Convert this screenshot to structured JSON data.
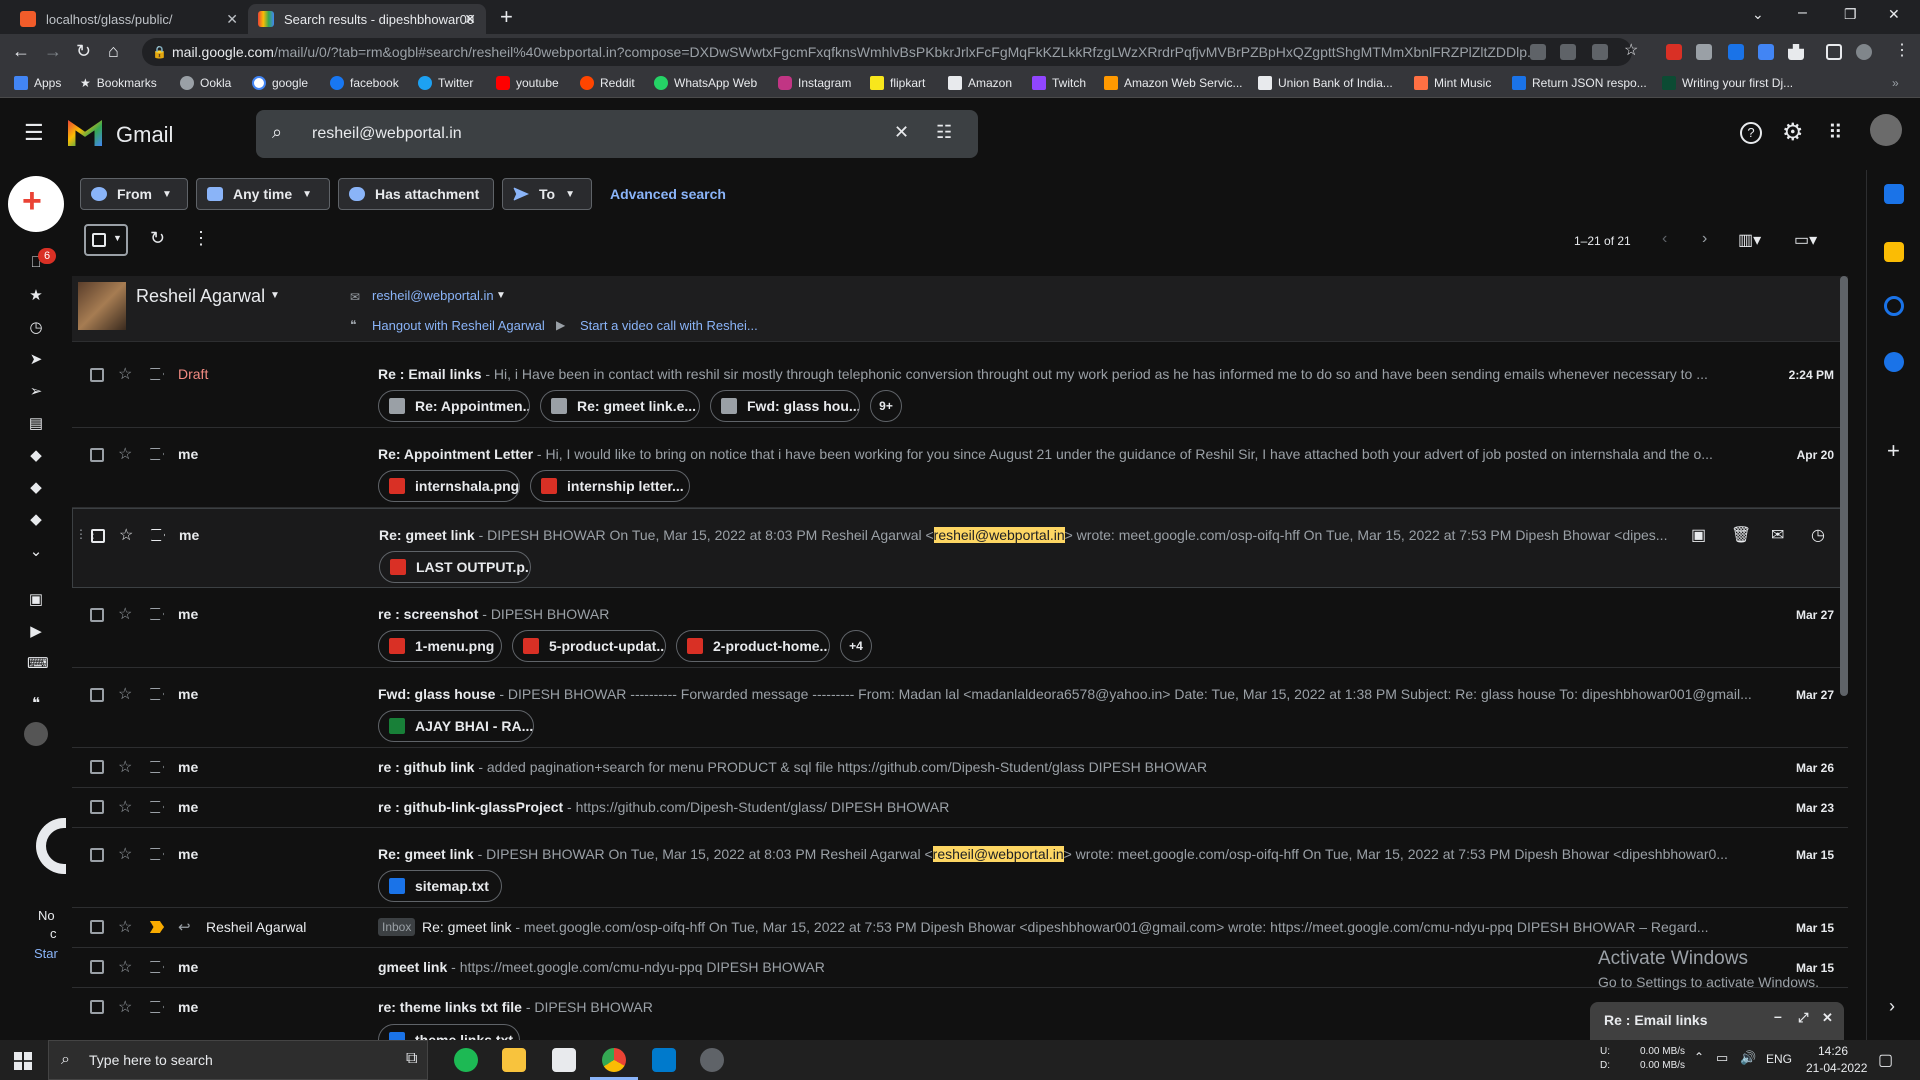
{
  "browser": {
    "tabs": [
      {
        "title": "localhost/glass/public/"
      },
      {
        "title": "Search results - dipeshbhowar00"
      }
    ],
    "url_host": "mail.google.com",
    "url_rest": "/mail/u/0/?tab=rm&ogbl#search/resheil%40webportal.in?compose=DXDwSWwtxFgcmFxqfknsWmhlvBsPKbkrJrlxFcFgMqFkKZLkkRfzgLWzXRrdrPqfjvMVBrPZBpHxQZgpttShgMTMmXbnlFRZPlZltZDDlp...",
    "bookmarks": [
      "Apps",
      "Bookmarks",
      "Ookla",
      "google",
      "facebook",
      "Twitter",
      "youtube",
      "Reddit",
      "WhatsApp Web",
      "Instagram",
      "flipkart",
      "Amazon",
      "Twitch",
      "Amazon Web Servic...",
      "Union Bank of India...",
      "Mint Music",
      "Return JSON respo...",
      "Writing your first Dj..."
    ]
  },
  "gmail": {
    "logo": "Gmail",
    "search_value": "resheil@webportal.in",
    "inbox_badge": "6",
    "filters": {
      "from": "From",
      "any_time": "Any time",
      "has_attachment": "Has attachment",
      "to": "To",
      "advanced": "Advanced search"
    },
    "pagination": "1–21 of 21",
    "contact": {
      "name": "Resheil Agarwal",
      "email": "resheil@webportal.in",
      "hangout": "Hangout with Resheil Agarwal",
      "video": "Start a video call with Reshei..."
    },
    "left_truncated": {
      "no": "No",
      "c": "c",
      "star": "Star"
    }
  },
  "emails": [
    {
      "sender": "Draft",
      "subject": "Re : Email links",
      "snippet": " - Hi, i Have been in contact with reshil sir mostly through telephonic conversion throught out my work period as he has informed me to do so and have been sending emails whenever necessary to ...",
      "date": "2:24 PM",
      "attachments": [
        "Re: Appointmen...",
        "Re: gmeet link.e...",
        "Fwd: glass hou..."
      ],
      "more": "9+"
    },
    {
      "sender": "me",
      "subject": "Re: Appointment Letter",
      "snippet": " - Hi, I would like to bring on notice that i have been working for you since August 21 under the guidance of Reshil Sir, I have attached both your advert of job posted on internshala and the o...",
      "date": "Apr 20",
      "attachments": [
        "internshala.png",
        "internship letter..."
      ]
    },
    {
      "sender": "me",
      "subject": "Re: gmeet link",
      "snippet_pre": " - DIPESH BHOWAR On Tue, Mar 15, 2022 at 8:03 PM Resheil Agarwal <",
      "highlight": "resheil@webportal.in",
      "snippet_post": "> wrote: meet.google.com/osp-oifq-hff On Tue, Mar 15, 2022 at 7:53 PM Dipesh Bhowar <dipes...",
      "attachments": [
        "LAST OUTPUT.p..."
      ]
    },
    {
      "sender": "me",
      "subject": "re : screenshot",
      "snippet": " - DIPESH BHOWAR",
      "date": "Mar 27",
      "attachments": [
        "1-menu.png",
        "5-product-updat...",
        "2-product-home..."
      ],
      "more": "+4"
    },
    {
      "sender": "me",
      "subject": "Fwd: glass house",
      "snippet": " - DIPESH BHOWAR ---------- Forwarded message --------- From: Madan lal <madanlaldeora6578@yahoo.in> Date: Tue, Mar 15, 2022 at 1:38 PM Subject: Re: glass house To: dipeshbhowar001@gmail...",
      "date": "Mar 27",
      "attachments": [
        "AJAY BHAI - RA..."
      ]
    },
    {
      "sender": "me",
      "subject": "re : github link",
      "snippet": " - added pagination+search for menu PRODUCT & sql file https://github.com/Dipesh-Student/glass DIPESH BHOWAR",
      "date": "Mar 26"
    },
    {
      "sender": "me",
      "subject": "re : github-link-glassProject",
      "snippet": " - https://github.com/Dipesh-Student/glass/ DIPESH BHOWAR",
      "date": "Mar 23"
    },
    {
      "sender": "me",
      "subject": "Re: gmeet link",
      "snippet_pre": " - DIPESH BHOWAR On Tue, Mar 15, 2022 at 8:03 PM Resheil Agarwal <",
      "highlight": "resheil@webportal.in",
      "snippet_post": "> wrote: meet.google.com/osp-oifq-hff On Tue, Mar 15, 2022 at 7:53 PM Dipesh Bhowar <dipeshbhowar0...",
      "date": "Mar 15",
      "attachments": [
        "sitemap.txt"
      ]
    },
    {
      "sender": "Resheil Agarwal",
      "label": "Inbox",
      "subject": "Re: gmeet link",
      "snippet": " - meet.google.com/osp-oifq-hff On Tue, Mar 15, 2022 at 7:53 PM Dipesh Bhowar <dipeshbhowar001@gmail.com> wrote: https://meet.google.com/cmu-ndyu-ppq DIPESH BHOWAR – Regard...",
      "date": "Mar 15"
    },
    {
      "sender": "me",
      "subject": "gmeet link",
      "snippet": " - https://meet.google.com/cmu-ndyu-ppq DIPESH BHOWAR",
      "date": "Mar 15"
    },
    {
      "sender": "me",
      "subject": "re: theme links txt file",
      "snippet": " - DIPESH BHOWAR",
      "date": "",
      "attachments": [
        "theme links.txt"
      ]
    }
  ],
  "overlay": {
    "activate_title": "Activate Windows",
    "activate_sub": "Go to Settings to activate Windows.",
    "draft_window": "Re : Email links"
  },
  "taskbar": {
    "search_placeholder": "Type here to search",
    "net_up": "U:",
    "net_down": "D:",
    "net_up_val": "0.00 MB/s",
    "net_down_val": "0.00 MB/s",
    "lang": "ENG",
    "time": "14:26",
    "date": "21-04-2022"
  }
}
